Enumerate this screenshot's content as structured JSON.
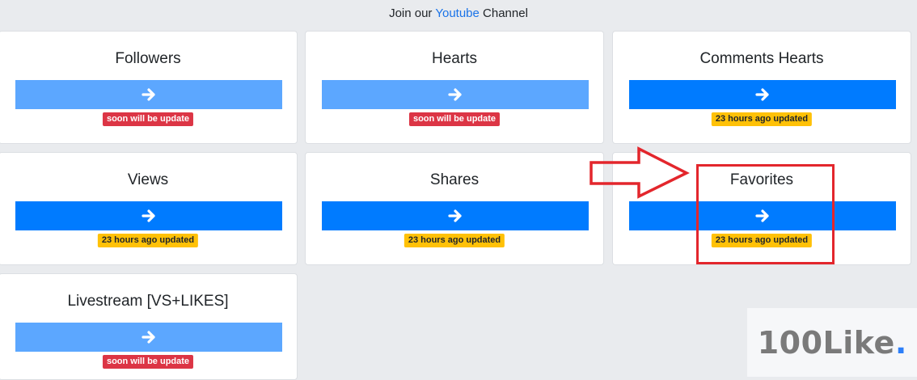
{
  "header": {
    "prefix": "Join our",
    "link": "Youtube",
    "suffix": "Channel"
  },
  "cards": [
    {
      "title": "Followers",
      "badge": "soon will be update",
      "badge_style": "red",
      "button_state": "inactive"
    },
    {
      "title": "Hearts",
      "badge": "soon will be update",
      "badge_style": "red",
      "button_state": "inactive"
    },
    {
      "title": "Comments Hearts",
      "badge": "23 hours ago updated",
      "badge_style": "yellow",
      "button_state": "active"
    },
    {
      "title": "Views",
      "badge": "23 hours ago updated",
      "badge_style": "yellow",
      "button_state": "active"
    },
    {
      "title": "Shares",
      "badge": "23 hours ago updated",
      "badge_style": "yellow",
      "button_state": "active"
    },
    {
      "title": "Favorites",
      "badge": "23 hours ago updated",
      "badge_style": "yellow",
      "button_state": "active"
    },
    {
      "title": "Livestream [VS+LIKES]",
      "badge": "soon will be update",
      "badge_style": "red",
      "button_state": "inactive"
    }
  ],
  "icons": {
    "card_button": "arrow-right-icon",
    "annotation": "outline-arrow-right-icon"
  },
  "annotation": {
    "highlighted_card": "Favorites"
  },
  "watermark": {
    "brand": "100Like",
    "dot": "."
  },
  "colors": {
    "background": "#e9ebee",
    "link": "#1a73e8",
    "button_active": "#007bff",
    "button_inactive": "#5ca7ff",
    "badge_red": "#dc3545",
    "badge_yellow": "#ffc107",
    "annotation_red": "#e3262c",
    "watermark_text": "#7a7a7a",
    "watermark_dot": "#2d7ff9"
  }
}
